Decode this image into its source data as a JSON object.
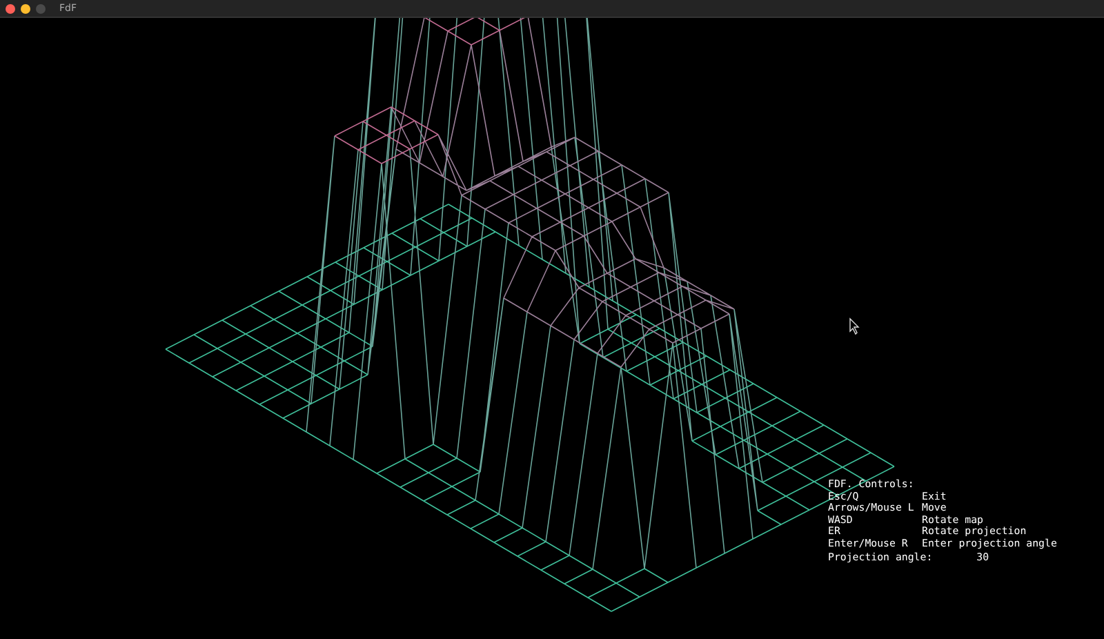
{
  "window": {
    "title": "FdF"
  },
  "controls": {
    "heading": "FDF. Controls:",
    "rows": [
      {
        "key": "Esc/Q",
        "action": "Exit"
      },
      {
        "key": "Arrows/Mouse L",
        "action": "Move"
      },
      {
        "key": "WASD",
        "action": "Rotate map"
      },
      {
        "key": "ER",
        "action": "Rotate projection"
      },
      {
        "key": "Enter/Mouse R",
        "action": "Enter projection angle"
      }
    ],
    "projection": {
      "label": "Projection angle:",
      "value": "30"
    }
  }
}
